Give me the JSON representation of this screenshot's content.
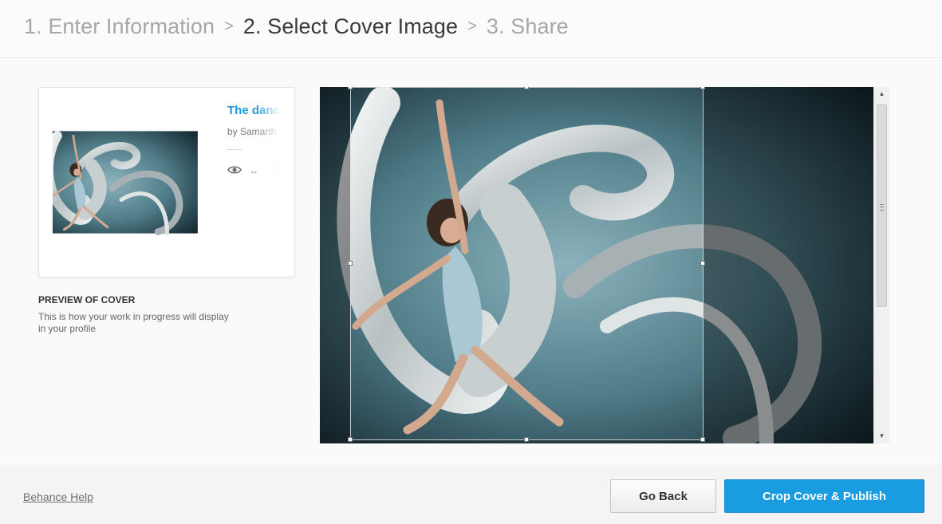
{
  "steps": {
    "step1": "1. Enter Information",
    "step2": "2. Select Cover Image",
    "step3": "3. Share",
    "separator": ">"
  },
  "card": {
    "title": "The danc",
    "owner": "by Samarth",
    "views": "--",
    "view_icon": "eye-icon"
  },
  "preview": {
    "label": "PREVIEW OF COVER",
    "description": "This is how your work in progress will display in your profile"
  },
  "cropper": {
    "image_subject": "dancer with white flowing ribbon"
  },
  "footer": {
    "help_link": "Behance Help",
    "back_button": "Go Back",
    "publish_button": "Crop Cover & Publish"
  },
  "colors": {
    "accent": "#1a9ce0",
    "title_link": "#1a9bdc"
  }
}
